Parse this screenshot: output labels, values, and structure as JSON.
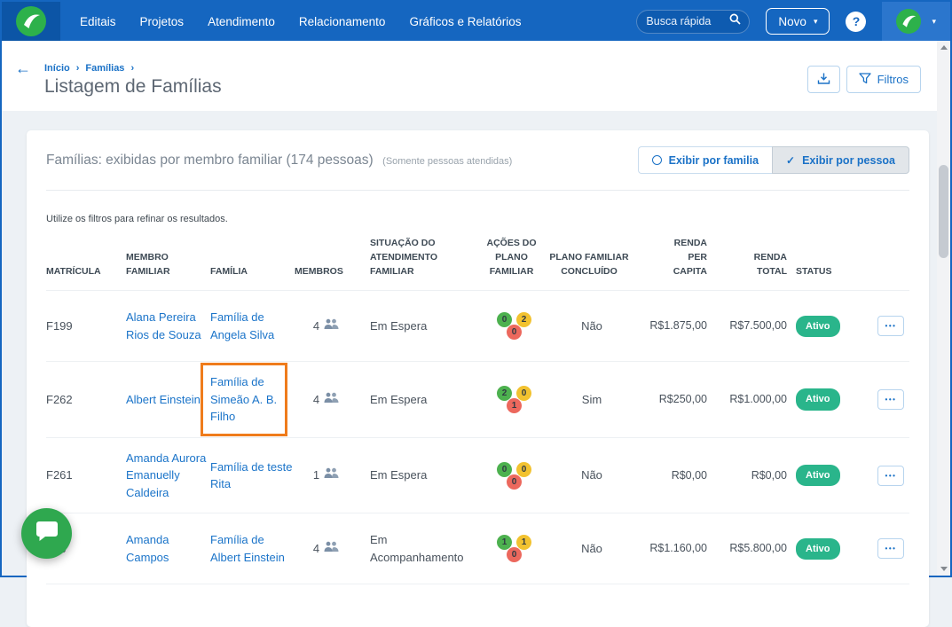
{
  "colors": {
    "navbar_bg": "#1566c0",
    "navbar_logo_bg": "#0c55a6",
    "accent_blue": "#1b72c7",
    "brand_green": "#2db14b",
    "status_active_green": "#2ab58b",
    "badge_green": "#4db14f",
    "badge_yellow": "#f2c230",
    "badge_red": "#ec685d",
    "highlight_orange": "#ef7c1c"
  },
  "icons": {
    "back": "←",
    "crumb_separator": "›",
    "caret_down": "▾",
    "check": "✓",
    "more": "•••"
  },
  "navbar": {
    "menu": [
      {
        "label": "Editais"
      },
      {
        "label": "Projetos"
      },
      {
        "label": "Atendimento"
      },
      {
        "label": "Relacionamento"
      },
      {
        "label": "Gráficos e Relatórios"
      }
    ],
    "search_placeholder": "Busca rápida",
    "new_button_label": "Novo",
    "help_label": "?"
  },
  "header": {
    "breadcrumb": [
      {
        "label": "Início"
      },
      {
        "label": "Famílias"
      }
    ],
    "title": "Listagem de Famílias",
    "filters_label": "Filtros"
  },
  "panel": {
    "title": "Famílias: exibidas por membro familiar (174 pessoas)",
    "subtitle": "(Somente pessoas atendidas)",
    "toggle_family_label": "Exibir por familia",
    "toggle_person_label": "Exibir por pessoa",
    "selected_toggle": "Exibir por pessoa",
    "hint": "Utilize os filtros para refinar os resultados."
  },
  "table": {
    "headers": {
      "matricula": "MATRÍCULA",
      "membro": "MEMBRO FAMILIAR",
      "familia": "FAMÍLIA",
      "membros": "MEMBROS",
      "situacao": "SITUAÇÃO DO ATENDIMENTO FAMILIAR",
      "acoes": "AÇÕES DO PLANO FAMILIAR",
      "concluido": "PLANO FAMILIAR CONCLUÍDO",
      "renda_per_capita": "RENDA PER CAPITA",
      "renda_total": "RENDA TOTAL",
      "status": "STATUS"
    },
    "rows": [
      {
        "matricula": "F199",
        "membro": "Alana Pereira Rios de Souza",
        "familia": "Família de Angela Silva",
        "membros": "4",
        "situacao": "Em Espera",
        "acoes": {
          "green": 0,
          "yellow": 2,
          "red": 0
        },
        "concluido": "Não",
        "renda_per_capita": "R$1.875,00",
        "renda_total": "R$7.500,00",
        "status": "Ativo"
      },
      {
        "matricula": "F262",
        "membro": "Albert Einstein",
        "familia": "Família de Simeão A. B. Filho",
        "membros": "4",
        "situacao": "Em Espera",
        "acoes": {
          "green": 2,
          "yellow": 0,
          "red": 1
        },
        "concluido": "Sim",
        "renda_per_capita": "R$250,00",
        "renda_total": "R$1.000,00",
        "status": "Ativo"
      },
      {
        "matricula": "F261",
        "membro": "Amanda Aurora Emanuelly Caldeira",
        "familia": "Família de teste Rita",
        "membros": "1",
        "situacao": "Em Espera",
        "acoes": {
          "green": 0,
          "yellow": 0,
          "red": 0
        },
        "concluido": "Não",
        "renda_per_capita": "R$0,00",
        "renda_total": "R$0,00",
        "status": "Ativo"
      },
      {
        "matricula": "F93",
        "membro": "Amanda Campos",
        "familia": "Família de Albert Einstein",
        "membros": "4",
        "situacao": "Em Acompanhamento",
        "acoes": {
          "green": 1,
          "yellow": 1,
          "red": 0
        },
        "concluido": "Não",
        "renda_per_capita": "R$1.160,00",
        "renda_total": "R$5.800,00",
        "status": "Ativo"
      }
    ]
  },
  "annotation": {
    "type": "highlight-box",
    "row_index": 1,
    "column": "familia",
    "color": "#ef7c1c"
  }
}
